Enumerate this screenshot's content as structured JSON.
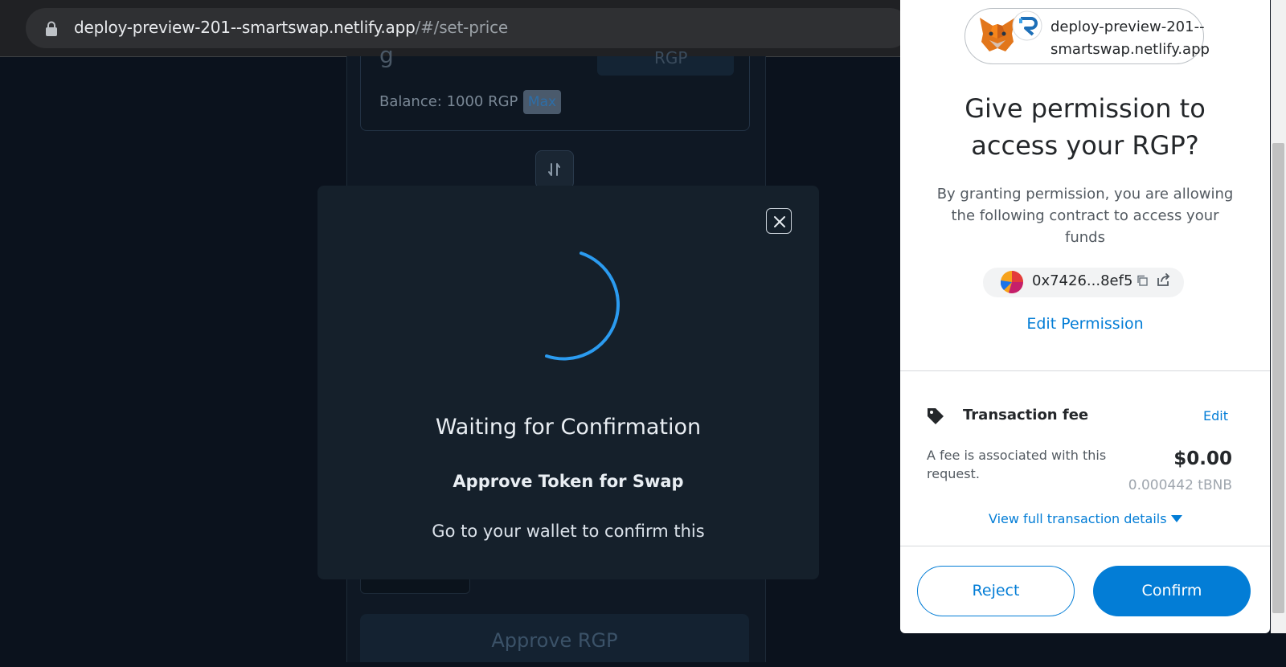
{
  "browser": {
    "url_host": "deploy-preview-201--smartswap.netlify.app",
    "url_path": "/#/set-price"
  },
  "app": {
    "balance_label": "Balance: 1000 RGP",
    "max_label": "Max",
    "token_symbol": "RGP",
    "partial_glyph": "g",
    "approve_button_label": "Approve RGP"
  },
  "modal": {
    "title": "Waiting for Confirmation",
    "subtitle": "Approve Token for Swap",
    "message": "Go to your wallet to confirm this"
  },
  "metamask": {
    "origin": "deploy-preview-201--smartswap.netlify.app",
    "title": "Give permission to access your RGP?",
    "description": "By granting permission, you are allowing the following contract to access your funds",
    "contract_address": "0x7426...8ef5",
    "edit_permission_label": "Edit Permission",
    "fee": {
      "title": "Transaction fee",
      "edit_label": "Edit",
      "description": "A fee is associated with this request.",
      "fiat_amount": "$0.00",
      "native_amount": "0.000442 tBNB",
      "view_details_label": "View full transaction details"
    },
    "reject_label": "Reject",
    "confirm_label": "Confirm"
  },
  "colors": {
    "accent": "#037dd6",
    "spinner": "#2b9bf0",
    "modal_bg": "#15202b",
    "page_bg": "#0b121d"
  }
}
